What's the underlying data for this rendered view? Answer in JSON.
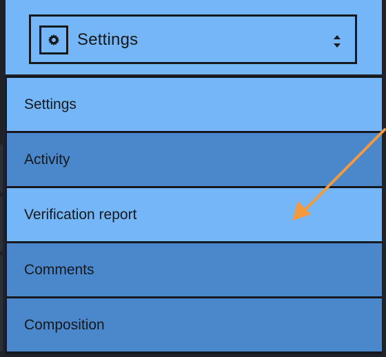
{
  "select": {
    "label": "Settings",
    "icon": "gear-icon",
    "indicator_icon": "sort-updown-icon"
  },
  "dropdown": {
    "options": [
      {
        "label": "Settings",
        "state": "light"
      },
      {
        "label": "Activity",
        "state": "dark"
      },
      {
        "label": "Verification report",
        "state": "light"
      },
      {
        "label": "Comments",
        "state": "dark"
      },
      {
        "label": "Composition",
        "state": "dark"
      }
    ]
  },
  "annotation": {
    "arrow_color": "#f59a3c",
    "points_to": "Verification report"
  },
  "colors": {
    "light_option": "#75b6f8",
    "dark_option": "#4b88cb",
    "border": "#15181c",
    "background": "#1f2329"
  }
}
